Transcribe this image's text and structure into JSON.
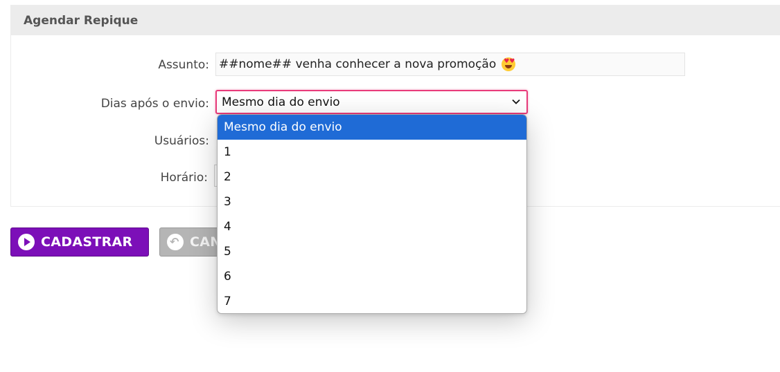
{
  "panel": {
    "title": "Agendar Repique"
  },
  "form": {
    "subject": {
      "label": "Assunto:",
      "value": "##nome## venha conhecer a nova promoção",
      "emoji": "heart-eyes-emoji"
    },
    "days_after": {
      "label": "Dias após o envio:",
      "value": "Mesmo dia do envio"
    },
    "users": {
      "label": "Usuários:"
    },
    "time": {
      "label": "Horário:"
    }
  },
  "dropdown": {
    "options": [
      "Mesmo dia do envio",
      "1",
      "2",
      "3",
      "4",
      "5",
      "6",
      "7"
    ],
    "selected_index": 0
  },
  "buttons": {
    "submit": "CADASTRAR",
    "cancel": "CAN"
  },
  "colors": {
    "primary": "#7c0fb8",
    "focus": "#e83a7a",
    "highlight": "#1f6bd6",
    "header_bg": "#ececec"
  }
}
